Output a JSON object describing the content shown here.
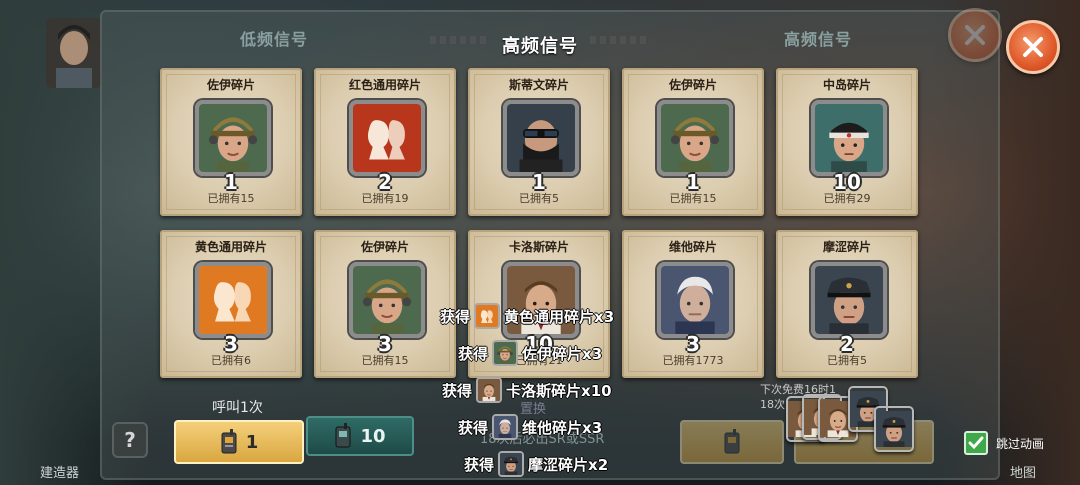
{
  "screen": {
    "title": "高频信号",
    "tab_left": "低频信号",
    "tab_right": "高频信号"
  },
  "cards": [
    {
      "name": "佐伊碎片",
      "count": "1",
      "owned": "已拥有15",
      "portrait": "zoe-portrait"
    },
    {
      "name": "红色通用碎片",
      "count": "2",
      "owned": "已拥有19",
      "portrait": "red-generic-fragment-icon"
    },
    {
      "name": "斯蒂文碎片",
      "count": "1",
      "owned": "已拥有5",
      "portrait": "steven-portrait"
    },
    {
      "name": "佐伊碎片",
      "count": "1",
      "owned": "已拥有15",
      "portrait": "zoe-portrait"
    },
    {
      "name": "中岛碎片",
      "count": "10",
      "owned": "已拥有29",
      "portrait": "nakajima-portrait"
    },
    {
      "name": "黄色通用碎片",
      "count": "3",
      "owned": "已拥有6",
      "portrait": "yellow-generic-fragment-icon"
    },
    {
      "name": "佐伊碎片",
      "count": "3",
      "owned": "已拥有15",
      "portrait": "zoe-portrait"
    },
    {
      "name": "卡洛斯碎片",
      "count": "10",
      "owned": "已拥有21",
      "portrait": "carlos-portrait"
    },
    {
      "name": "维他碎片",
      "count": "3",
      "owned": "已拥有1773",
      "portrait": "vita-portrait"
    },
    {
      "name": "摩涩碎片",
      "count": "2",
      "owned": "已拥有5",
      "portrait": "mose-portrait"
    }
  ],
  "rewards": [
    {
      "prefix": "获得",
      "text": "黄色通用碎片x3",
      "icon": "yellow-generic-fragment-icon"
    },
    {
      "prefix": "获得",
      "text": "佐伊碎片x3",
      "icon": "zoe-portrait"
    },
    {
      "prefix": "获得",
      "text": "卡洛斯碎片x10",
      "icon": "carlos-portrait"
    },
    {
      "prefix": "获得",
      "text": "维他碎片x3",
      "icon": "vita-portrait"
    },
    {
      "prefix": "获得",
      "text": "摩涩碎片x2",
      "icon": "mose-portrait"
    }
  ],
  "controls": {
    "call_once_label": "呼叫1次",
    "call_once_cost": "1",
    "call_ten_cost": "10",
    "help": "?",
    "guarantee_text": "18次后必出SR或SSR",
    "swap_text": "置换",
    "free_next_line1": "下次免费16时1",
    "free_next_line2": "18次",
    "skip_animation": "跳过动画",
    "left_building": "建造器",
    "right_building": "地图"
  },
  "colors": {
    "card_bg": "#dccdb0",
    "gold_button": "#f4d07a",
    "close_orange": "#e0592a",
    "teal_button": "#2f6b66",
    "check_green": "#3fa84a"
  }
}
